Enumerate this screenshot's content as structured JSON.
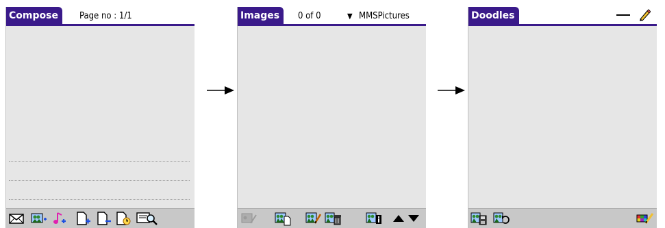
{
  "screens": {
    "compose": {
      "title": "Compose",
      "page_info": "Page no : 1/1",
      "toolbar_icons": [
        "message-icon",
        "add-image-icon",
        "add-sound-icon",
        "add-page-icon",
        "remove-page-icon",
        "page-timing-icon",
        "preview-icon"
      ]
    },
    "images": {
      "title": "Images",
      "count": "0 of 0",
      "folder_arrow": "▼",
      "folder": "MMSPictures",
      "toolbar_icons": [
        "edit-image-icon",
        "copy-image-icon",
        "draw-image-icon",
        "delete-image-icon",
        "image-info-icon",
        "scroll-up-icon",
        "scroll-down-icon"
      ]
    },
    "doodles": {
      "title": "Doodles",
      "toolbar_icons": [
        "save-doodle-icon",
        "undo-doodle-icon",
        "color-palette-icon"
      ]
    }
  },
  "colors": {
    "title_bar": "#3a1a8a",
    "screen_bg": "#e6e6e6",
    "toolbar_bg": "#c8c8c8"
  }
}
